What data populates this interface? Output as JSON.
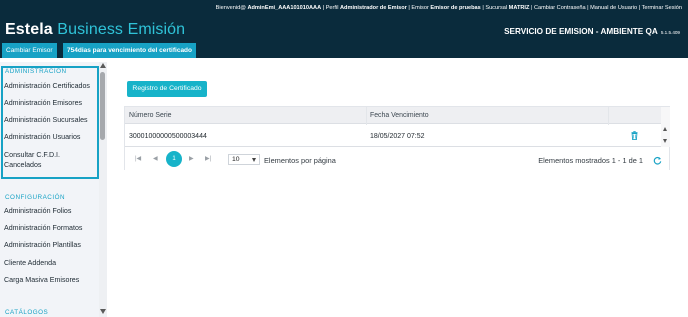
{
  "header": {
    "welcome_prefix": "Bienvenid@",
    "user": "AdminEmi_AAA101010AAA",
    "perfil_prefix": "| Perfil",
    "perfil": "Administrador de Emisor",
    "emisor_prefix": "| Emisor",
    "emisor": "Emisor de pruebas",
    "sucursal_prefix": "| Sucursal",
    "sucursal": "MATRIZ",
    "link_password": "| Cambiar Contraseña",
    "link_manual": "| Manual de Usuario",
    "link_logout": "| Terminar Sesión",
    "brand_main": "Estela",
    "brand_sub": "Business Emisión",
    "service": "SERVICIO DE EMISION - AMBIENTE QA",
    "version": "5.1.5.409"
  },
  "tabs": {
    "cambiar_emisor": "Cambiar Emisor",
    "vencimiento": "754dias para vencimiento del certificado"
  },
  "sidebar": {
    "sections": [
      {
        "title": "ADMINISTRACIÓN",
        "items": [
          "Administración Certificados",
          "Administración Emisores",
          "Administración Sucursales",
          "Administración Usuarios",
          "Consultar C.F.D.I.",
          "Cancelados"
        ]
      },
      {
        "title": "CONFIGURACIÓN",
        "items": [
          "Administración Folios",
          "Administración Formatos",
          "Administración Plantillas",
          "Cliente Addenda",
          "Carga Masiva Emisores"
        ]
      },
      {
        "title": "CATÁLOGOS",
        "items": []
      }
    ]
  },
  "main": {
    "register_button": "Registro de Certificado",
    "columns": [
      "Número Serie",
      "Fecha Vencimiento"
    ],
    "rows": [
      [
        "30001000000500003444",
        "18/05/2027 07:52"
      ]
    ],
    "pager": {
      "current_page": "1",
      "page_size": "10",
      "page_size_label": "Elementos por página",
      "summary": "Elementos mostrados 1 - 1 de 1"
    }
  },
  "colors": {
    "header_bg": "#0a2b3c",
    "accent": "#17a2c5",
    "button": "#17b3c9"
  },
  "icons": {
    "delete": "trash-icon",
    "refresh": "refresh-icon",
    "first_page": "first-page-icon",
    "prev_page": "prev-page-icon",
    "next_page": "next-page-icon",
    "last_page": "last-page-icon"
  }
}
